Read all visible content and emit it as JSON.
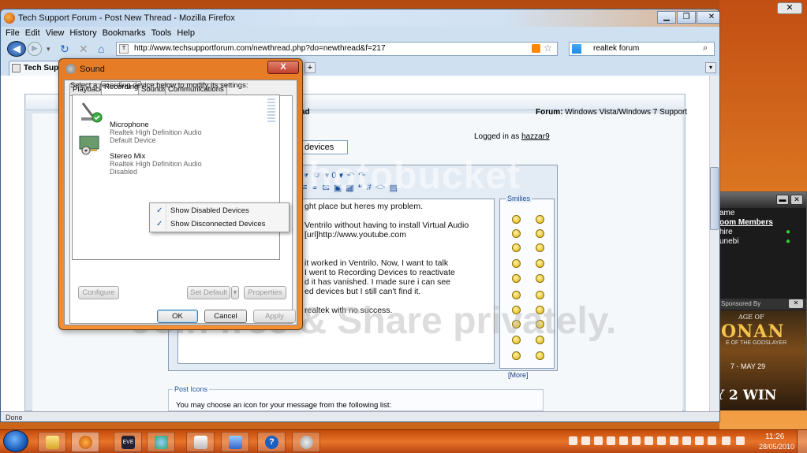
{
  "browser": {
    "window_title": "Tech Support Forum - Post New Thread - Mozilla Firefox",
    "menu": [
      "File",
      "Edit",
      "View",
      "History",
      "Bookmarks",
      "Tools",
      "Help"
    ],
    "url": "http://www.techsupportforum.com/newthread.php?do=newthread&f=217",
    "search_value": "realtek forum",
    "tab_label": "Tech Supp",
    "status": "Done"
  },
  "page": {
    "header_title": "ad",
    "forum_label": "Forum:",
    "forum_value": "Windows Vista/Windows 7 Support",
    "logged_in_label": "Logged in as",
    "username": "hazzar9",
    "thread_title_value": "devices",
    "message_lines": [
      "ght place but heres my problem.",
      "Ventrilo without having to install Virtual Audio",
      "[url]http://www.youtube.com",
      "it worked in Ventrilo. Now, I want to talk",
      "I went to Recording Devices to reactivate",
      "d it has vanished. I made sure i can see",
      "ed devices but I still can't find it.",
      "realtek with no success."
    ],
    "smilies_title": "Smilies",
    "more_link": "[More]",
    "post_icons_title": "Post Icons",
    "post_icons_text": "You may choose an icon for your message from the following list:",
    "watermark_top": "photobucket",
    "watermark_bottom": "Join free & Share privately."
  },
  "sound_dialog": {
    "title": "Sound",
    "close": "X",
    "tabs": [
      "Playback",
      "Recording",
      "Sounds",
      "Communications"
    ],
    "active_tab": "Recording",
    "instruction": "Select a recording device below to modify its settings:",
    "devices": [
      {
        "name": "Microphone",
        "driver": "Realtek High Definition Audio",
        "status": "Default Device"
      },
      {
        "name": "Stereo Mix",
        "driver": "Realtek High Definition Audio",
        "status": "Disabled"
      }
    ],
    "context_menu": [
      {
        "label": "Show Disabled Devices",
        "checked": true
      },
      {
        "label": "Show Disconnected Devices",
        "checked": true
      }
    ],
    "buttons": {
      "configure": "Configure",
      "set_default": "Set Default",
      "properties": "Properties",
      "ok": "OK",
      "cancel": "Cancel",
      "apply": "Apply"
    }
  },
  "gadget": {
    "rows": [
      "ame",
      "oom Members",
      "hire",
      "unebi"
    ],
    "ad_bar": "Sponsored By",
    "ad_age": "AGE OF",
    "ad_title": "ONAN",
    "ad_sub": "E OF THE GODSLAYER",
    "ad_date": "Y 2 WIN",
    "ad_dates": "7 - MAY 29"
  },
  "taskbar": {
    "time": "11:26",
    "date": "28/05/2010"
  },
  "colors": {
    "accent": "#e67c25",
    "taskbar": "#c44b0a",
    "link": "#1a4f99"
  },
  "icons": [
    "firefox-icon",
    "folder-icon",
    "eve-icon",
    "people-icon",
    "network-icon",
    "help-icon",
    "cd-icon"
  ]
}
